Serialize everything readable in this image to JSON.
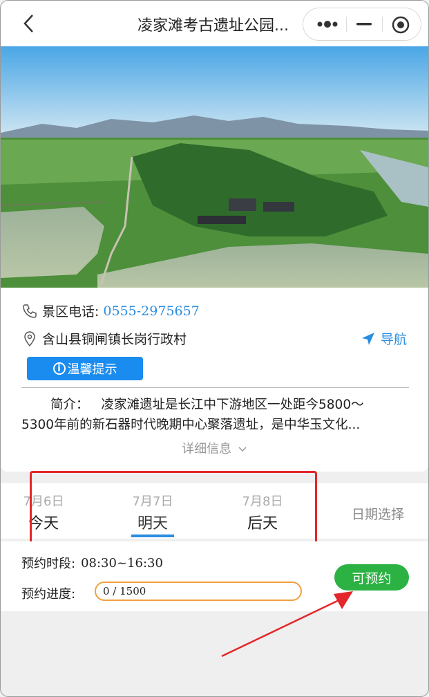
{
  "header": {
    "title": "凌家滩考古遗址公园..."
  },
  "contact": {
    "phone_label": "景区电话:",
    "phone_number": "0555-2975657",
    "address": "含山县铜闸镇长岗行政村",
    "nav_label": "导航"
  },
  "tips_label": "温馨提示",
  "tips_icon_glyph": "i",
  "intro": {
    "title": "简介：",
    "line1": "凌家滩遗址是长江中下游地区一处距今5800～",
    "line2": "5300年前的新石器时代晚期中心聚落遗址，是中华玉文化..."
  },
  "details_label": "详细信息",
  "dates": [
    {
      "date": "7月6日",
      "name": "今天"
    },
    {
      "date": "7月7日",
      "name": "明天"
    },
    {
      "date": "7月8日",
      "name": "后天"
    }
  ],
  "selected_date_index": 1,
  "date_picker_label": "日期选择",
  "slot": {
    "time_label": "预约时段:",
    "time_value": "08:30~16:30",
    "progress_label": "预约进度:",
    "progress_text": "0 / 1500",
    "progress_fraction": 0
  },
  "book_button_label": "可预约",
  "colors": {
    "accent": "#2a8de0",
    "book": "#2cb143",
    "annotation": "#e3262b",
    "progress_border": "#f0a040"
  },
  "icons": [
    "back-icon",
    "more-icon",
    "minimize-icon",
    "close-icon",
    "phone-icon",
    "location-icon",
    "navigation-icon",
    "info-icon",
    "chevron-down-icon"
  ]
}
